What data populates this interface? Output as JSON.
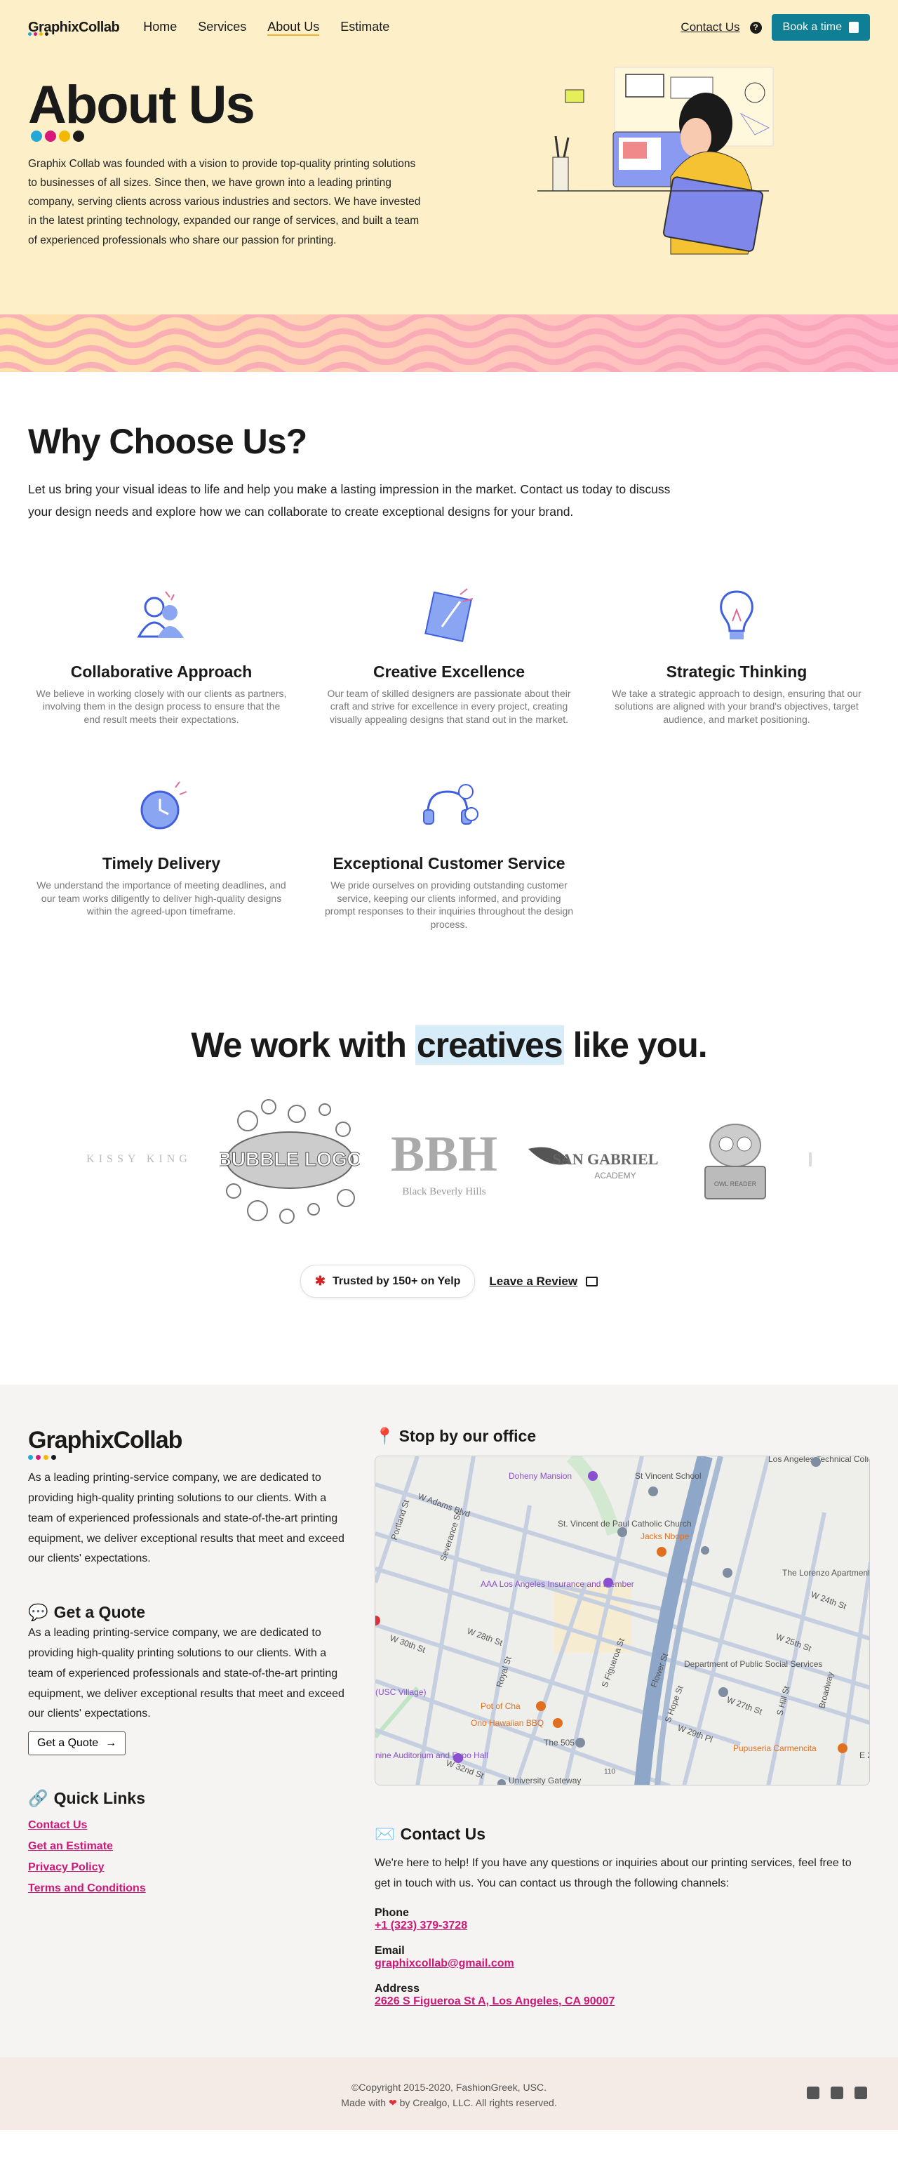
{
  "nav": {
    "logo": "GraphixCollab",
    "links": [
      "Home",
      "Services",
      "About Us",
      "Estimate"
    ],
    "active": "About Us",
    "contact": "Contact Us",
    "book": "Book a time"
  },
  "hero": {
    "title": "About Us",
    "text": "Graphix Collab was founded with a vision to provide top-quality printing solutions to businesses of all sizes. Since then, we have grown into a leading printing company, serving clients across various industries and sectors. We have invested in the latest printing technology, expanded our range of services, and built a team of experienced professionals who share our passion for printing."
  },
  "brand_colors": {
    "cyan": "#22a7d6",
    "magenta": "#d8187a",
    "yellow": "#f5b800",
    "black": "#1a1a1a",
    "teal_button": "#0f7f95",
    "link_pink": "#cc1877"
  },
  "why": {
    "title": "Why Choose Us?",
    "intro": "Let us bring your visual ideas to life and help you make a lasting impression in the market. Contact us today to discuss your design needs and explore how we can collaborate to create exceptional designs for your brand.",
    "features": [
      {
        "title": "Collaborative Approach",
        "text": "We believe in working closely with our clients as partners, involving them in the design process to ensure that the end result meets their expectations.",
        "icon": "people-icon"
      },
      {
        "title": "Creative Excellence",
        "text": "Our team of skilled designers are passionate about their craft and strive for excellence in every project, creating visually appealing designs that stand out in the market.",
        "icon": "design-card-icon"
      },
      {
        "title": "Strategic Thinking",
        "text": "We take a strategic approach to design, ensuring that our solutions are aligned with your brand's objectives, target audience, and market positioning.",
        "icon": "lightbulb-icon"
      },
      {
        "title": "Timely Delivery",
        "text": "We understand the importance of meeting deadlines, and our team works diligently to deliver high-quality designs within the agreed-upon timeframe.",
        "icon": "clock-icon"
      },
      {
        "title": "Exceptional Customer Service",
        "text": "We pride ourselves on providing outstanding customer service, keeping our clients informed, and providing prompt responses to their inquiries throughout the design process.",
        "icon": "headset-icon"
      }
    ]
  },
  "creatives": {
    "title_before": "We work with ",
    "title_highlight": "creatives",
    "title_after": " like you.",
    "logos": [
      "KISSY KING",
      "BUBBLE LOGO",
      "BBH",
      "Black Beverly Hills",
      "SAN GABRIEL",
      "ACADEMY",
      "OWL READER"
    ],
    "yelp": "Trusted by 150+ on Yelp",
    "review": "Leave a Review"
  },
  "footer": {
    "logo": "GraphixCollab",
    "about": "As a leading printing-service company, we are dedicated to providing high-quality printing solutions to our clients. With a team of experienced professionals and state-of-the-art printing equipment, we deliver exceptional results that meet and exceed our clients' expectations.",
    "quote_title": "Get a Quote",
    "quote_text": "As a leading printing-service company, we are dedicated to providing high-quality printing solutions to our clients. With a team of experienced professionals and state-of-the-art printing equipment, we deliver exceptional results that meet and exceed our clients' expectations.",
    "quote_button": "Get a Quote",
    "quick_links_title": "Quick Links",
    "quick_links": [
      "Contact Us",
      "Get an Estimate",
      "Privacy Policy",
      "Terms and Conditions"
    ],
    "office_title": "Stop by our office",
    "map_labels": [
      "Doheny Mansion",
      "St Vincent School",
      "Los Angeles Technical College",
      "St. Vincent de Paul Catholic Church",
      "Jacks Nbope",
      "The Lorenzo Apartments",
      "AAA Los Angeles Insurance and Member",
      "Department of Public Social Services",
      "Pot of Cha",
      "Ono Hawaiian BBQ",
      "The 505",
      "Pupuseria Carmencita",
      "W Adams Blvd",
      "W 28th St",
      "W 30th St",
      "W 27th St",
      "W 25th St",
      "W 24th St",
      "S Figueroa St",
      "Flower St",
      "S Hope St",
      "Portland St",
      "Severance St",
      "Royal St",
      "W 32nd St",
      "W 29th Pl",
      "Broadway",
      "S Hill St",
      "E 2",
      "(USC Village)",
      "nine Auditorium and Expo Hall",
      "University Gateway",
      "110"
    ],
    "contact_title": "Contact Us",
    "contact_intro": "We're here to help! If you have any questions or inquiries about our printing services, feel free to get in touch with us. You can contact us through the following channels:",
    "phone_label": "Phone",
    "phone": "+1 (323) 379-3728",
    "email_label": "Email",
    "email": "graphixcollab@gmail.com",
    "address_label": "Address",
    "address": "2626 S Figueroa St A, Los Angeles, CA 90007"
  },
  "bottom": {
    "copyright": "©Copyright 2015-2020, FashionGreek, USC.",
    "made_prefix": "Made with",
    "made_suffix": "by Crealgo, LLC. All rights reserved.",
    "socials": [
      "facebook-icon",
      "twitter-icon",
      "instagram-icon"
    ]
  }
}
